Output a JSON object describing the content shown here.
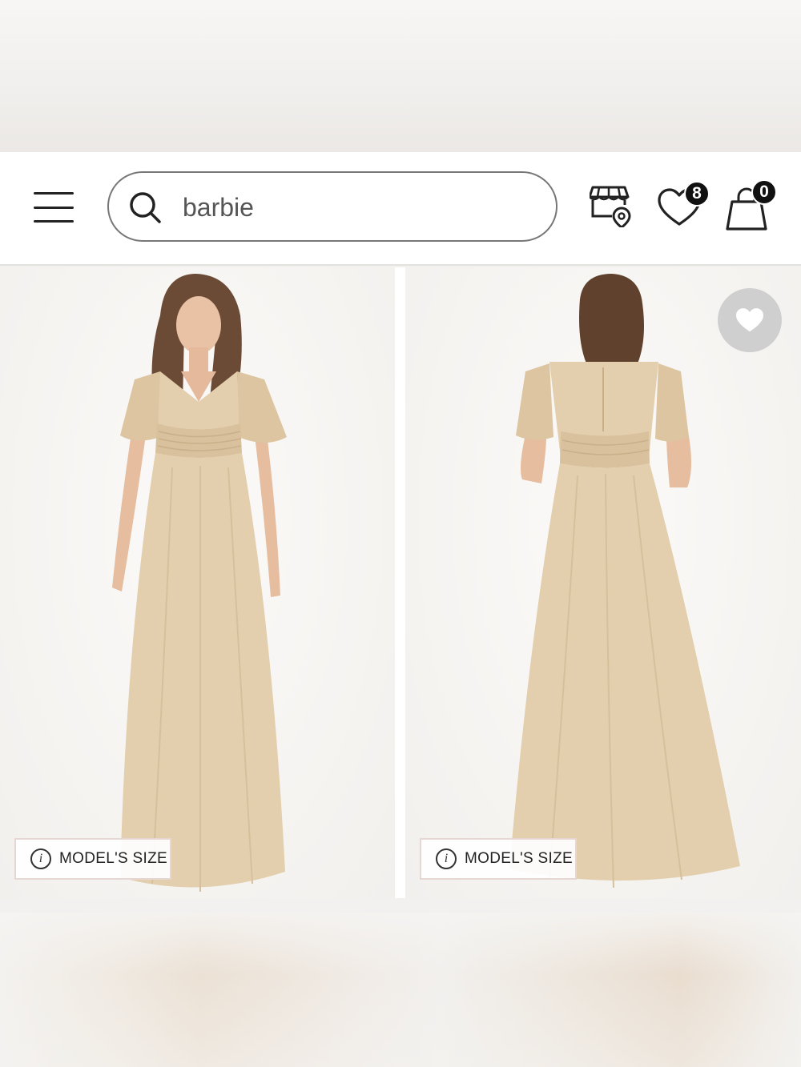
{
  "header": {
    "search": {
      "value": "barbie",
      "placeholder": ""
    },
    "wishlist_count": "8",
    "bag_count": "0"
  },
  "gallery": {
    "images": [
      {
        "view": "front",
        "model_size_label": "MODEL'S SIZE"
      },
      {
        "view": "back",
        "model_size_label": "MODEL'S SIZE"
      }
    ]
  },
  "colors": {
    "dress": "#e3cfad",
    "badge": "#111111",
    "fav_button": "#cfcfcf"
  },
  "icons": [
    "hamburger-menu-icon",
    "search-icon",
    "store-locator-icon",
    "heart-icon",
    "shopping-bag-icon",
    "info-icon"
  ]
}
